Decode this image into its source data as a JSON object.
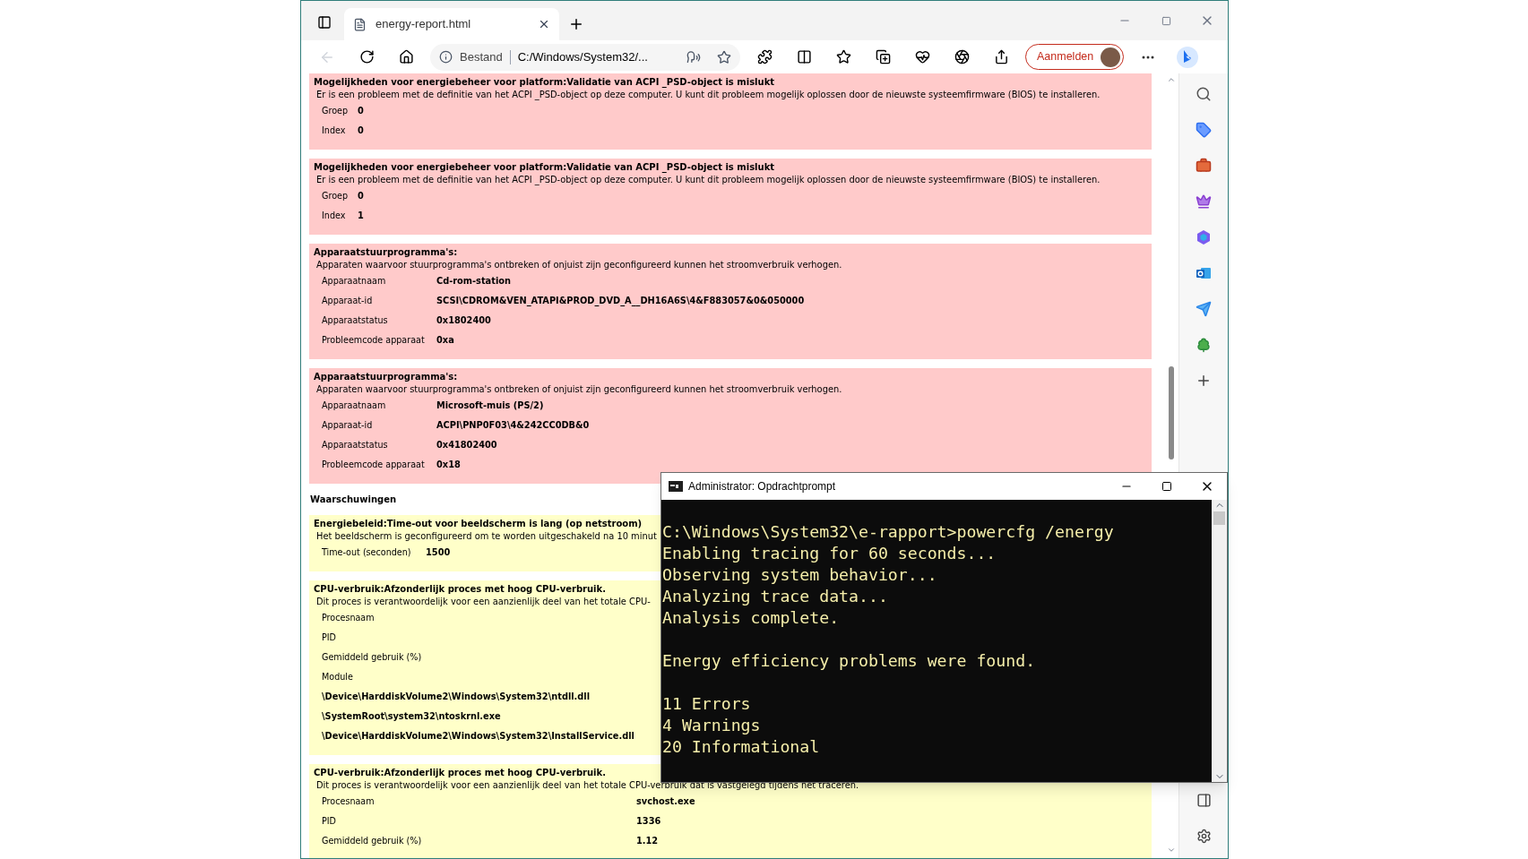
{
  "browser": {
    "tab": {
      "title": "energy-report.html"
    },
    "address": {
      "scheme": "Bestand",
      "url": "C:/Windows/System32/..."
    },
    "sign_in": "Aanmelden"
  },
  "report": {
    "errors": [
      {
        "kind": "platform",
        "title": "Mogelijkheden voor energiebeheer voor platform:Validatie van ACPI _PSD-object is mislukt",
        "description": "Er is een probleem met de definitie van het ACPI _PSD-object op deze computer. U kunt dit probleem mogelijk oplossen door de nieuwste systeemfirmware (BIOS) te installeren.",
        "rows": [
          {
            "kind": "field",
            "label": "Groep",
            "value": "0"
          },
          {
            "kind": "field",
            "label": "Index",
            "value": "0"
          }
        ]
      },
      {
        "kind": "platform",
        "title": "Mogelijkheden voor energiebeheer voor platform:Validatie van ACPI _PSD-object is mislukt",
        "description": "Er is een probleem met de definitie van het ACPI _PSD-object op deze computer. U kunt dit probleem mogelijk oplossen door de nieuwste systeemfirmware (BIOS) te installeren.",
        "rows": [
          {
            "kind": "field",
            "label": "Groep",
            "value": "0"
          },
          {
            "kind": "field",
            "label": "Index",
            "value": "1"
          }
        ]
      },
      {
        "kind": "device",
        "title": "Apparaatstuurprogramma's:",
        "description": "Apparaten waarvoor stuurprogramma's ontbreken of onjuist zijn geconfigureerd kunnen het stroomverbruik verhogen.",
        "rows": [
          {
            "kind": "field",
            "label": "Apparaatnaam",
            "value": "Cd-rom-station"
          },
          {
            "kind": "field",
            "label": "Apparaat-id",
            "value": "SCSI\\CDROM&VEN_ATAPI&PROD_DVD_A__DH16A6S\\4&F883057&0&050000"
          },
          {
            "kind": "field",
            "label": "Apparaatstatus",
            "value": "0x1802400"
          },
          {
            "kind": "field",
            "label": "Probleemcode apparaat",
            "value": "0xa"
          }
        ]
      },
      {
        "kind": "device",
        "title": "Apparaatstuurprogramma's:",
        "description": "Apparaten waarvoor stuurprogramma's ontbreken of onjuist zijn geconfigureerd kunnen het stroomverbruik verhogen.",
        "rows": [
          {
            "kind": "field",
            "label": "Apparaatnaam",
            "value": "Microsoft-muis (PS/2)"
          },
          {
            "kind": "field",
            "label": "Apparaat-id",
            "value": "ACPI\\PNP0F03\\4&242CC0DB&0"
          },
          {
            "kind": "field",
            "label": "Apparaatstatus",
            "value": "0x41802400"
          },
          {
            "kind": "field",
            "label": "Probleemcode apparaat",
            "value": "0x18"
          }
        ]
      }
    ],
    "warnings_heading": "Waarschuwingen",
    "warnings": [
      {
        "kind": "display",
        "title": "Energiebeleid:Time-out voor beeldscherm is lang (op netstroom)",
        "description": "Het beeldscherm is geconfigureerd om te worden uitgeschakeld na 10 minut",
        "rows": [
          {
            "kind": "field",
            "label": "Time-out (seconden)",
            "value": "1500"
          }
        ]
      },
      {
        "kind": "process",
        "title": "CPU-verbruik:Afzonderlijk proces met hoog CPU-verbruik.",
        "description": "Dit proces is verantwoordelijk voor een aanzienlijk deel van het totale CPU-",
        "rows": [
          {
            "kind": "field",
            "label": "Procesnaam"
          },
          {
            "kind": "field",
            "label": "PID"
          },
          {
            "kind": "field",
            "label": "Gemiddeld gebruik (%)"
          },
          {
            "kind": "field",
            "label": "Module"
          },
          {
            "kind": "path",
            "label": "\\Device\\HarddiskVolume2\\Windows\\System32\\ntdll.dll"
          },
          {
            "kind": "path",
            "label": "\\SystemRoot\\system32\\ntoskrnl.exe"
          },
          {
            "kind": "path",
            "label": "\\Device\\HarddiskVolume2\\Windows\\System32\\InstallService.dll"
          }
        ]
      },
      {
        "kind": "process",
        "title": "CPU-verbruik:Afzonderlijk proces met hoog CPU-verbruik.",
        "description": "Dit proces is verantwoordelijk voor een aanzienlijk deel van het totale CPU-verbruik dat is vastgelegd tijdens het traceren.",
        "rows": [
          {
            "kind": "field",
            "label": "Procesnaam",
            "value": "svchost.exe"
          },
          {
            "kind": "field",
            "label": "PID",
            "value": "1336"
          },
          {
            "kind": "field",
            "label": "Gemiddeld gebruik (%)",
            "value": "1.12"
          }
        ]
      }
    ]
  },
  "console": {
    "title": "Administrator: Opdrachtprompt",
    "paragraphs": [
      [
        "C:\\Windows\\System32\\e-rapport>powercfg /energy",
        "Enabling tracing for 60 seconds...",
        "Observing system behavior...",
        "Analyzing trace data...",
        "Analysis complete."
      ],
      [
        "Energy efficiency problems were found."
      ],
      [
        "11 Errors",
        "4 Warnings",
        "20 Informational"
      ]
    ]
  }
}
